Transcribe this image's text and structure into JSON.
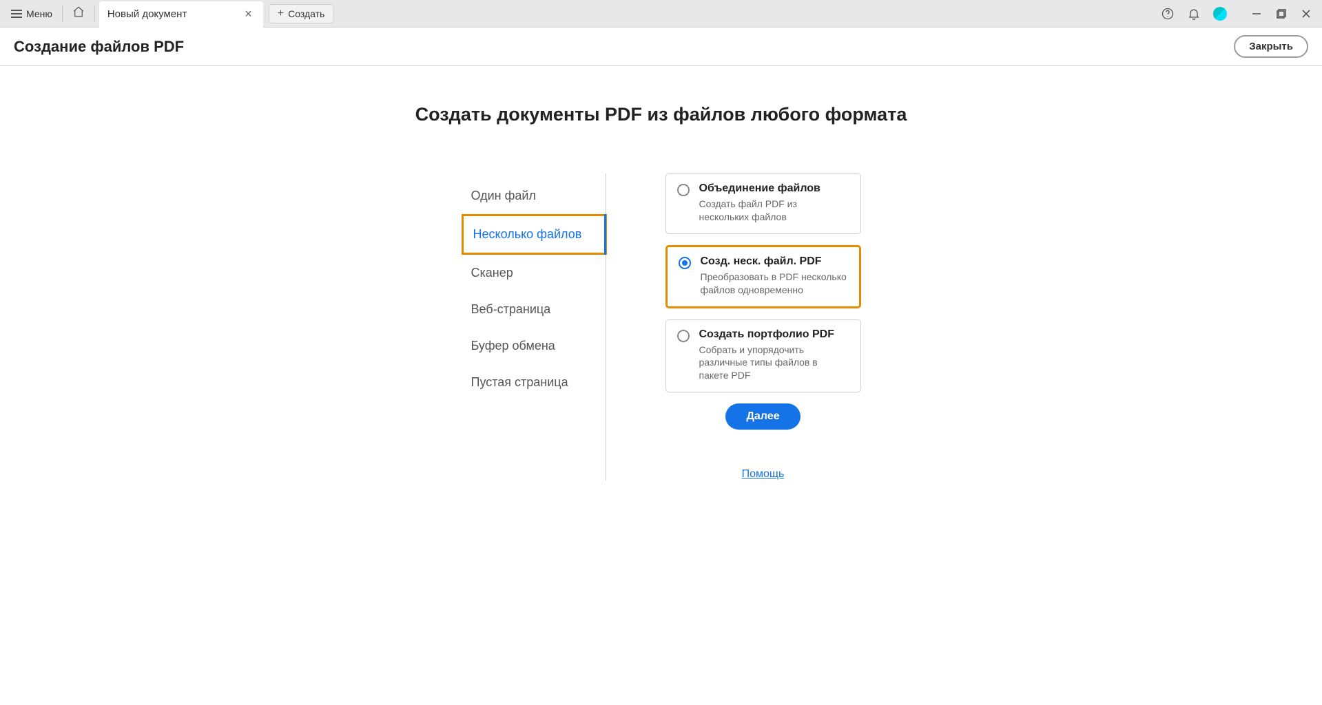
{
  "toolbar": {
    "menu_label": "Меню",
    "tab_title": "Новый документ",
    "create_label": "Создать"
  },
  "subheader": {
    "title": "Создание файлов PDF",
    "close_label": "Закрыть"
  },
  "main": {
    "heading": "Создать документы PDF из файлов любого формата",
    "left_items": [
      "Один файл",
      "Несколько файлов",
      "Сканер",
      "Веб-страница",
      "Буфер обмена",
      "Пустая страница"
    ],
    "options": [
      {
        "title": "Объединение файлов",
        "desc": "Создать файл PDF из нескольких файлов"
      },
      {
        "title": "Созд. неск. файл. PDF",
        "desc": "Преобразовать в PDF несколько файлов одновременно"
      },
      {
        "title": "Создать портфолио PDF",
        "desc": "Собрать и упорядочить различные типы файлов в пакете PDF"
      }
    ],
    "next_label": "Далее",
    "help_label": "Помощь"
  }
}
